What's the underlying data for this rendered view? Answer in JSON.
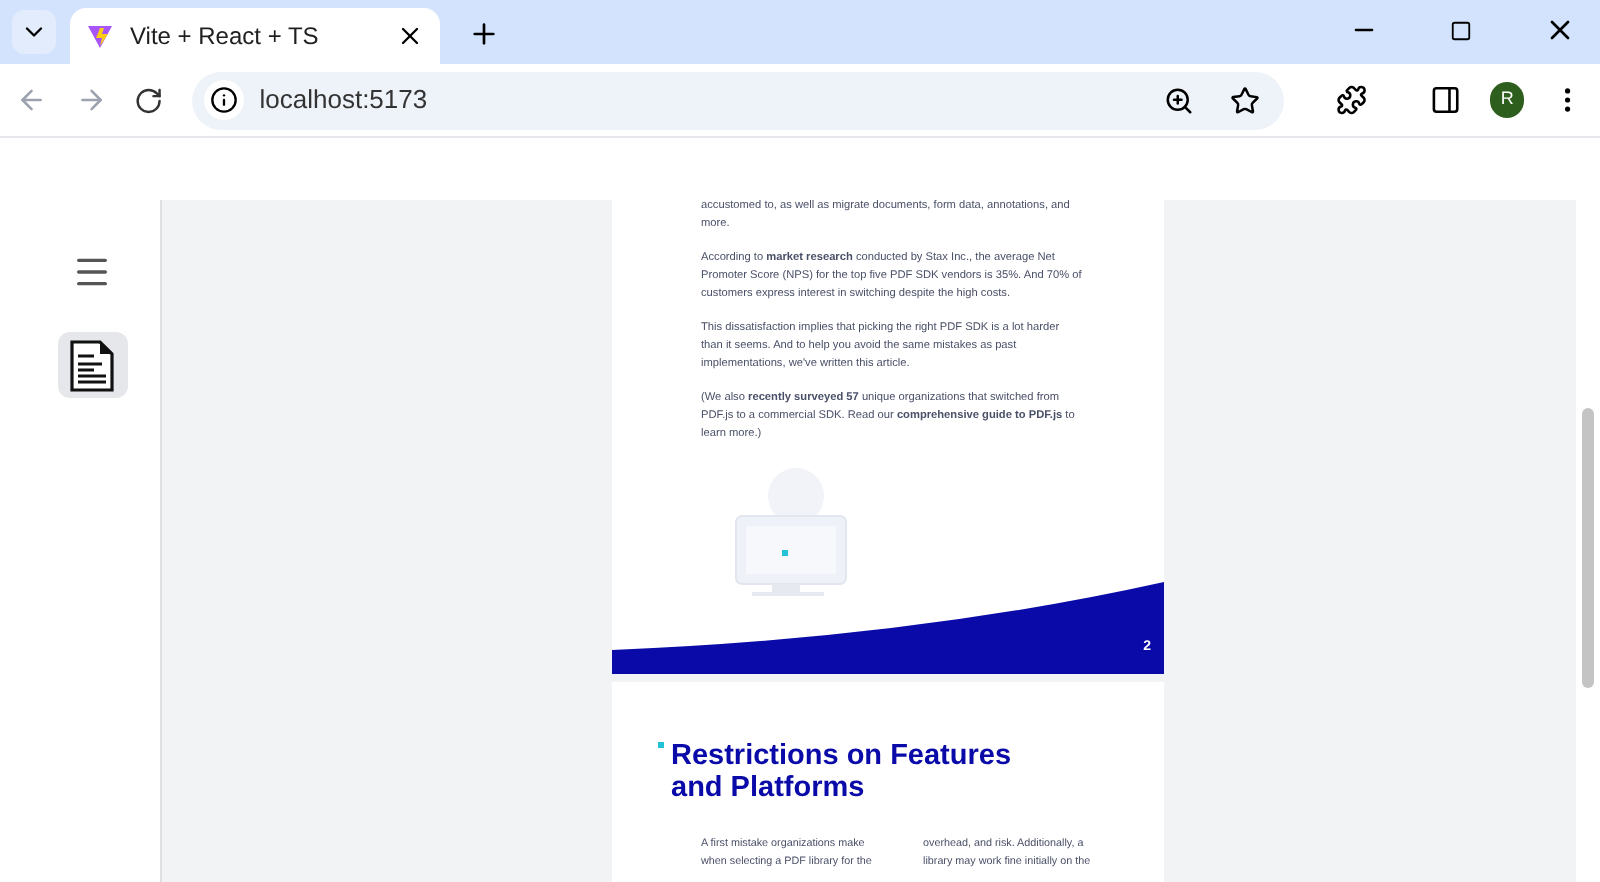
{
  "browser": {
    "tab": {
      "title": "Vite + React + TS",
      "selected": true
    },
    "address": "localhost:5173",
    "profile": "R"
  },
  "sidebar": {
    "items": [
      {
        "kind": "menu",
        "selected": false
      },
      {
        "kind": "document",
        "selected": true
      }
    ]
  },
  "pages": [
    {
      "kind": "text",
      "paragraphs": [
        "accustomed to, as well as migrate documents, form data, annotations, and more.",
        "According to **market research** conducted by Stax Inc., the average Net Promoter Score (NPS) for the top five PDF SDK vendors is 35%. And 70% of customers express interest in switching despite the high costs.",
        "This dissatisfaction implies that picking the right PDF SDK is a lot harder than it seems. And to help you avoid the same mistakes as past implementations, we've written this article.",
        "(We also **recently surveyed 57** unique organizations that switched from PDF.js to a commercial SDK. Read our **comprehensive guide to PDF.js** to learn more.)"
      ],
      "page_number": "2"
    },
    {
      "kind": "heading",
      "title": [
        "Restrictions on Features",
        "and Platforms"
      ],
      "columns": [
        [
          "A first mistake organizations make",
          "when selecting a PDF library for the"
        ],
        [
          "overhead, and risk. Additionally, a",
          "library may work fine initially on the"
        ]
      ]
    }
  ]
}
